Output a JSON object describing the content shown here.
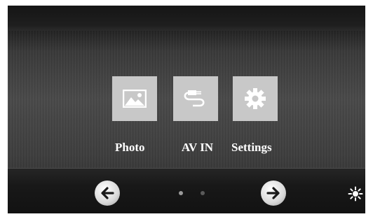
{
  "menu": {
    "items": [
      {
        "label": "Photo",
        "icon": "photo-icon"
      },
      {
        "label": "AV IN",
        "icon": "av-plug-icon"
      },
      {
        "label": "Settings",
        "icon": "gear-icon"
      }
    ]
  },
  "navigation": {
    "prev_icon": "arrow-left-icon",
    "next_icon": "arrow-right-icon",
    "page_count": 2,
    "current_page": 1,
    "brightness_icon": "brightness-icon"
  }
}
